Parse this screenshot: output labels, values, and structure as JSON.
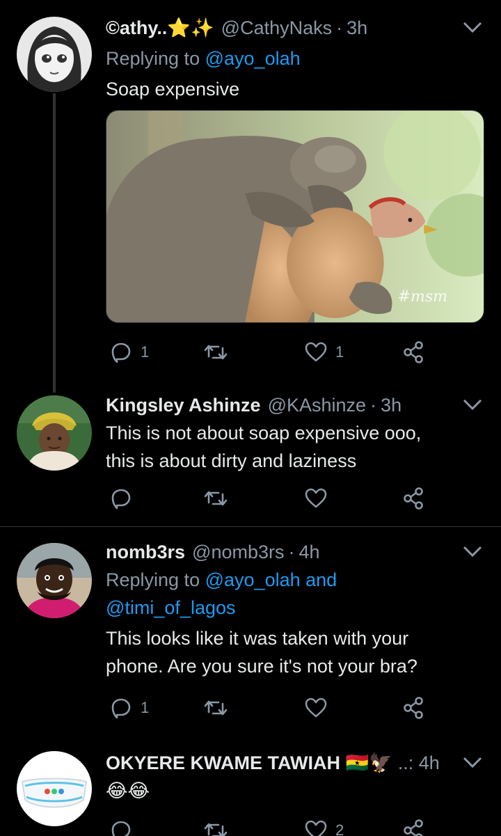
{
  "tweets": [
    {
      "name": "©athy..⭐✨",
      "handle": "@CathyNaks",
      "time": "3h",
      "replying_label": "Replying to",
      "replying_to": "@ayo_olah",
      "text": "Soap expensive",
      "media": {
        "watermark": "#msm"
      },
      "counts": {
        "reply": "1",
        "retweet": "",
        "like": "1"
      }
    },
    {
      "name": "Kingsley Ashinze",
      "handle": "@KAshinze",
      "time": "3h",
      "text_lines": [
        "This is not about soap expensive ooo,",
        "this is about dirty and laziness"
      ],
      "counts": {
        "reply": "",
        "retweet": "",
        "like": ""
      }
    },
    {
      "name": "nomb3rs",
      "handle": "@nomb3rs",
      "time": "4h",
      "replying_label": "Replying to",
      "replying_to": "@ayo_olah",
      "replying_and": "and",
      "replying_to_2": "@timi_of_lagos",
      "text_lines": [
        "This looks like it was taken with your",
        "phone. Are you sure it's not your bra?"
      ],
      "counts": {
        "reply": "1",
        "retweet": "",
        "like": ""
      }
    },
    {
      "name": "OKYERE KWAME TAWIAH 🇬🇭🦅",
      "meta": "..: 4h",
      "text": "😂😂",
      "counts": {
        "reply": "",
        "retweet": "",
        "like": "2"
      }
    }
  ],
  "colors": {
    "background": "#000000",
    "text": "#e7e9ea",
    "muted": "#8b98a5",
    "link": "#1d9bf0",
    "divider": "#2f3336"
  },
  "icons": [
    "reply-icon",
    "retweet-icon",
    "like-icon",
    "share-icon",
    "chevron-down-icon"
  ]
}
